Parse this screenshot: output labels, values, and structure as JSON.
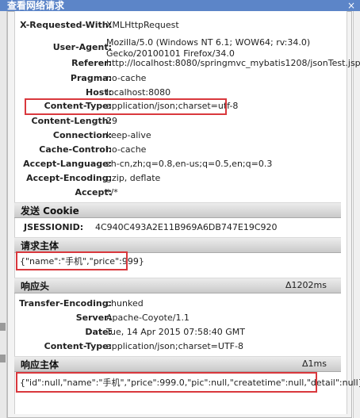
{
  "window": {
    "title": "查看网络请求",
    "close_glyph": "×"
  },
  "request_headers": [
    {
      "label": "X-Requested-With:",
      "value": "XMLHttpRequest"
    },
    {
      "label": "User-Agent:",
      "value": "Mozilla/5.0 (Windows NT 6.1; WOW64; rv:34.0)",
      "value2": "Gecko/20100101 Firefox/34.0"
    },
    {
      "label": "Referer:",
      "value": "http://localhost:8080/springmvc_mybatis1208/jsonTest.jsp"
    },
    {
      "label": "Pragma:",
      "value": "no-cache"
    },
    {
      "label": "Host:",
      "value": "localhost:8080"
    },
    {
      "label": "Content-Type:",
      "value": "application/json;charset=utf-8"
    },
    {
      "label": "Content-Length:",
      "value": "29"
    },
    {
      "label": "Connection:",
      "value": "keep-alive"
    },
    {
      "label": "Cache-Control:",
      "value": "no-cache"
    },
    {
      "label": "Accept-Language:",
      "value": "zh-cn,zh;q=0.8,en-us;q=0.5,en;q=0.3"
    },
    {
      "label": "Accept-Encoding:",
      "value": "gzip, deflate"
    },
    {
      "label": "Accept:",
      "value": "*/*"
    }
  ],
  "cookie_section": {
    "title": "发送 Cookie",
    "label": "JSESSIONID:",
    "value": "4C940C493A2E11B969A6DB747E19C920"
  },
  "request_body_section": {
    "title": "请求主体",
    "body": "{\"name\":\"手机\",\"price\":999}"
  },
  "response_headers_section": {
    "title": "响应头",
    "time": "Δ1202ms",
    "rows": [
      {
        "label": "Transfer-Encoding:",
        "value": "chunked"
      },
      {
        "label": "Server:",
        "value": "Apache-Coyote/1.1"
      },
      {
        "label": "Date:",
        "value": "Tue, 14 Apr 2015 07:58:40 GMT"
      },
      {
        "label": "Content-Type:",
        "value": "application/json;charset=UTF-8"
      }
    ]
  },
  "response_body_section": {
    "title": "响应主体",
    "time": "Δ1ms",
    "body": "{\"id\":null,\"name\":\"手机\",\"price\":999.0,\"pic\":null,\"createtime\":null,\"detail\":null}"
  }
}
